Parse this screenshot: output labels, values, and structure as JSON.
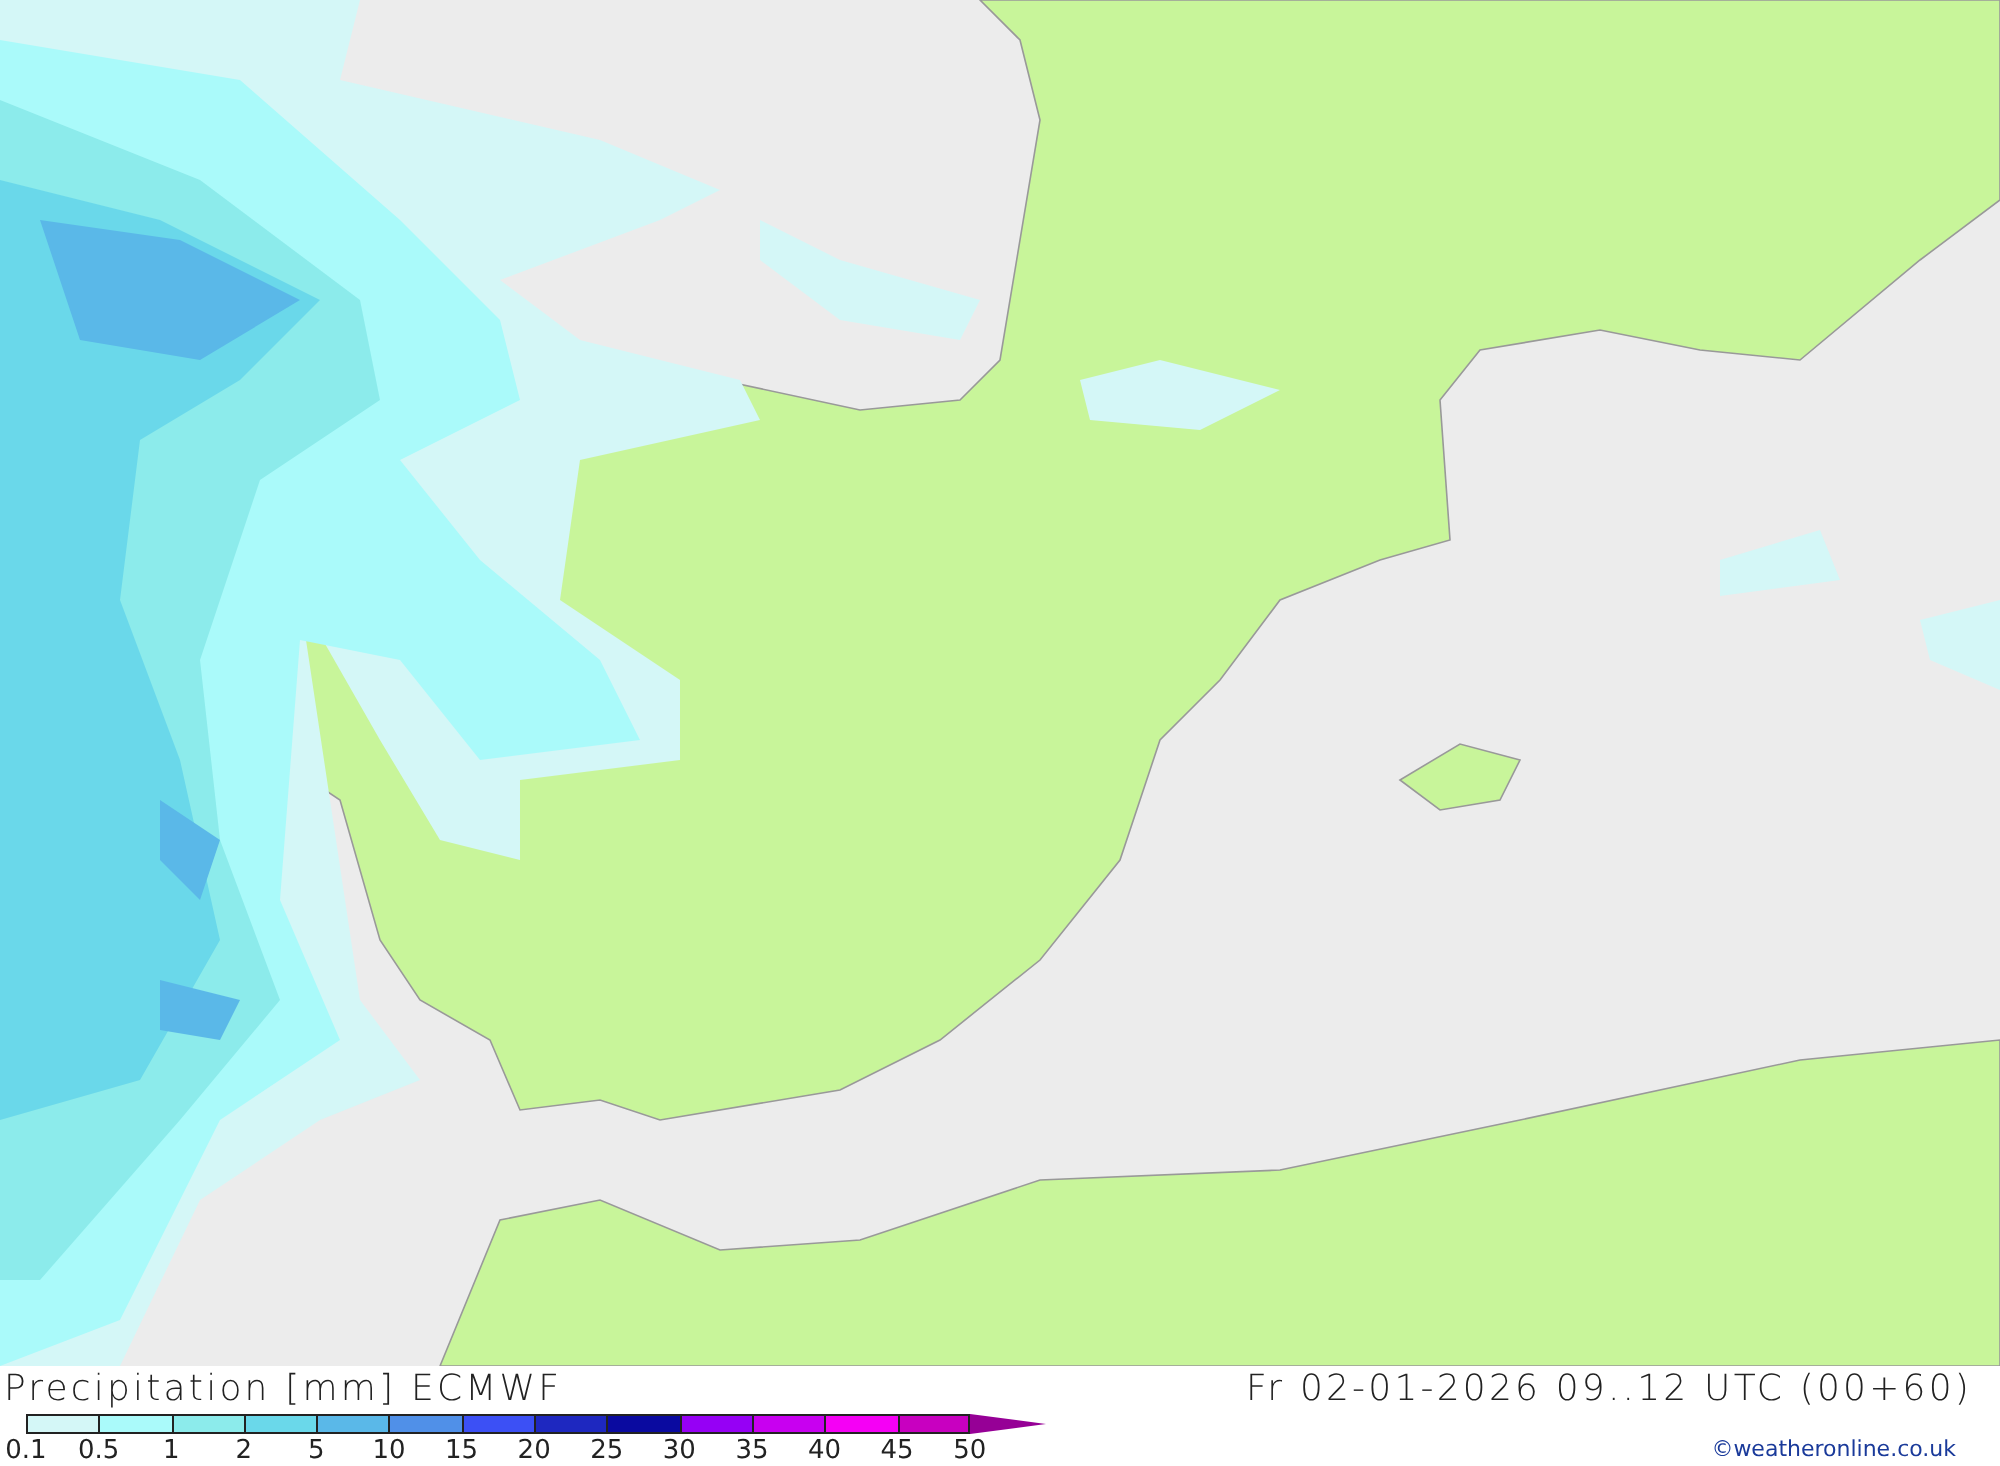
{
  "title": "Precipitation [mm] ECMWF",
  "valid_time": "Fr 02-01-2026 09..12 UTC (00+60)",
  "legend": {
    "items": [
      {
        "label": "0.1",
        "color": "#d4f7f7"
      },
      {
        "label": "0.5",
        "color": "#aafafa"
      },
      {
        "label": "1",
        "color": "#8cebeb"
      },
      {
        "label": "2",
        "color": "#6ad8ea"
      },
      {
        "label": "5",
        "color": "#5ab8e8"
      },
      {
        "label": "10",
        "color": "#5090e8"
      },
      {
        "label": "15",
        "color": "#3c50f5"
      },
      {
        "label": "20",
        "color": "#1e28c0"
      },
      {
        "label": "25",
        "color": "#0a0aa0"
      },
      {
        "label": "30",
        "color": "#9600f5"
      },
      {
        "label": "35",
        "color": "#c800f0"
      },
      {
        "label": "40",
        "color": "#f500f5"
      },
      {
        "label": "45",
        "color": "#c800c0"
      },
      {
        "label": "50",
        "color": "#960096"
      }
    ]
  },
  "credit": "©weatheronline.co.uk"
}
